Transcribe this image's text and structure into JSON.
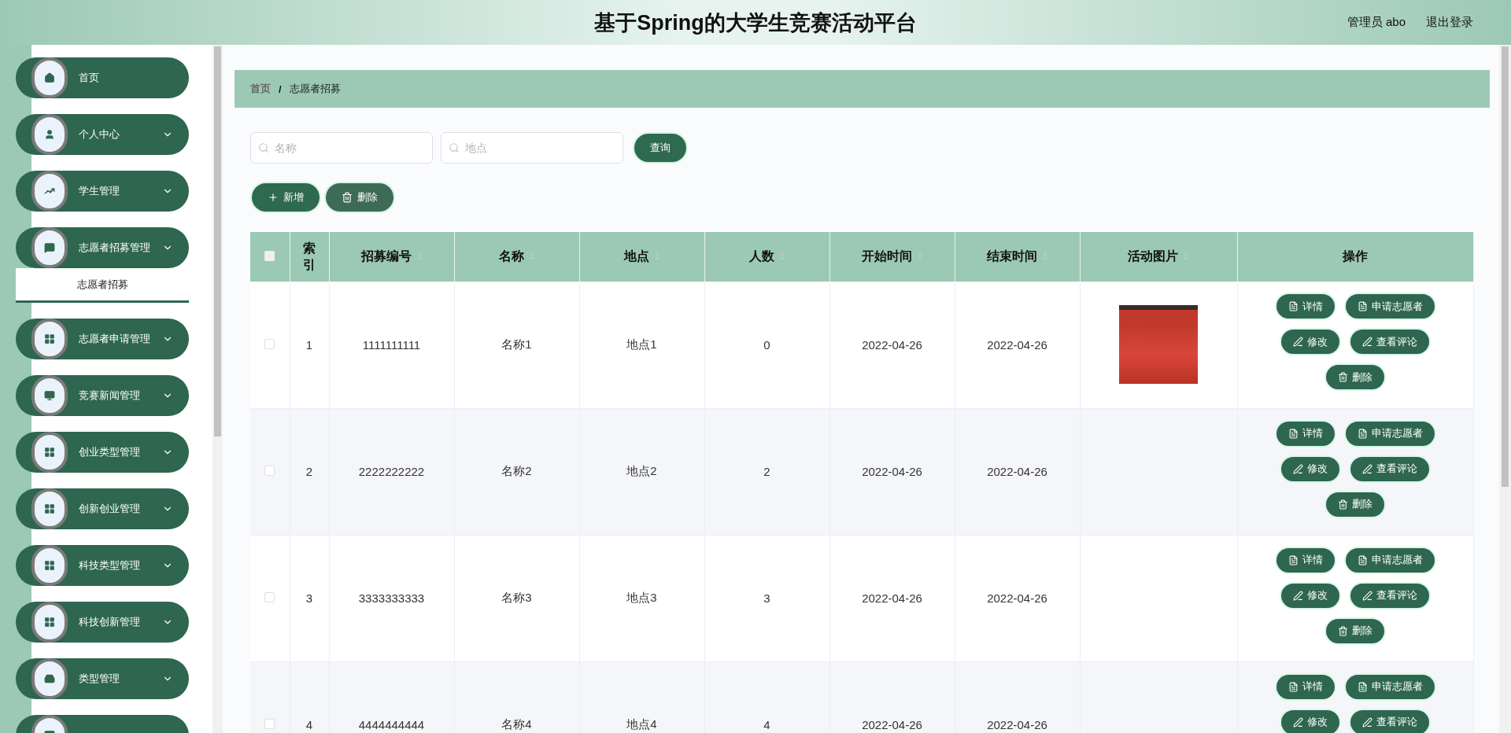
{
  "header": {
    "title": "基于Spring的大学生竞赛活动平台",
    "user": "管理员 abo",
    "logout": "退出登录"
  },
  "sidebar": {
    "items": [
      {
        "label": "首页",
        "expandable": false
      },
      {
        "label": "个人中心",
        "expandable": true
      },
      {
        "label": "学生管理",
        "expandable": true
      },
      {
        "label": "志愿者招募管理",
        "expandable": true,
        "children": [
          {
            "label": "志愿者招募",
            "selected": true
          }
        ]
      },
      {
        "label": "志愿者申请管理",
        "expandable": true
      },
      {
        "label": "竞赛新闻管理",
        "expandable": true
      },
      {
        "label": "创业类型管理",
        "expandable": true
      },
      {
        "label": "创新创业管理",
        "expandable": true
      },
      {
        "label": "科技类型管理",
        "expandable": true
      },
      {
        "label": "科技创新管理",
        "expandable": true
      },
      {
        "label": "类型管理",
        "expandable": true
      }
    ]
  },
  "breadcrumb": [
    "首页",
    "/",
    "志愿者招募"
  ],
  "search": {
    "fields": [
      {
        "placeholder": "名称"
      },
      {
        "placeholder": "地点"
      }
    ],
    "button": "查询"
  },
  "toolbar": [
    {
      "kind": "add",
      "label": "新增"
    },
    {
      "kind": "delete",
      "label": "删除"
    }
  ],
  "table": {
    "all_checked": false,
    "columns": [
      {
        "label": "索引",
        "sortable": false
      },
      {
        "label": "招募编号",
        "sortable": true
      },
      {
        "label": "名称",
        "sortable": true
      },
      {
        "label": "地点",
        "sortable": true
      },
      {
        "label": "人数",
        "sortable": true
      },
      {
        "label": "开始时间",
        "sortable": true
      },
      {
        "label": "结束时间",
        "sortable": true
      },
      {
        "label": "活动图片",
        "sortable": true
      },
      {
        "label": "操作",
        "sortable": false
      }
    ],
    "rows": [
      {
        "checked": false,
        "cells": [
          "1",
          "1111111111",
          "名称1",
          "地点1",
          "0",
          "2022-04-26",
          "2022-04-26"
        ],
        "photo": true,
        "actions": [
          {
            "kind": "doc",
            "label": "详情"
          },
          {
            "kind": "doc",
            "label": "申请志愿者"
          },
          {
            "kind": "edit",
            "label": "修改"
          },
          {
            "kind": "edit",
            "label": "查看评论"
          },
          {
            "kind": "delete",
            "label": "删除"
          }
        ]
      },
      {
        "checked": false,
        "cells": [
          "2",
          "2222222222",
          "名称2",
          "地点2",
          "2",
          "2022-04-26",
          "2022-04-26"
        ],
        "photo": false,
        "actions": [
          {
            "kind": "doc",
            "label": "详情"
          },
          {
            "kind": "doc",
            "label": "申请志愿者"
          },
          {
            "kind": "edit",
            "label": "修改"
          },
          {
            "kind": "edit",
            "label": "查看评论"
          },
          {
            "kind": "delete",
            "label": "删除"
          }
        ]
      },
      {
        "checked": false,
        "cells": [
          "3",
          "3333333333",
          "名称3",
          "地点3",
          "3",
          "2022-04-26",
          "2022-04-26"
        ],
        "photo": false,
        "actions": [
          {
            "kind": "doc",
            "label": "详情"
          },
          {
            "kind": "doc",
            "label": "申请志愿者"
          },
          {
            "kind": "edit",
            "label": "修改"
          },
          {
            "kind": "edit",
            "label": "查看评论"
          },
          {
            "kind": "delete",
            "label": "删除"
          }
        ]
      },
      {
        "checked": false,
        "cells": [
          "4",
          "4444444444",
          "名称4",
          "地点4",
          "4",
          "2022-04-26",
          "2022-04-26"
        ],
        "photo": false,
        "actions": [
          {
            "kind": "doc",
            "label": "详情"
          },
          {
            "kind": "doc",
            "label": "申请志愿者"
          },
          {
            "kind": "edit",
            "label": "修改"
          },
          {
            "kind": "edit",
            "label": "查看评论"
          }
        ]
      }
    ]
  }
}
